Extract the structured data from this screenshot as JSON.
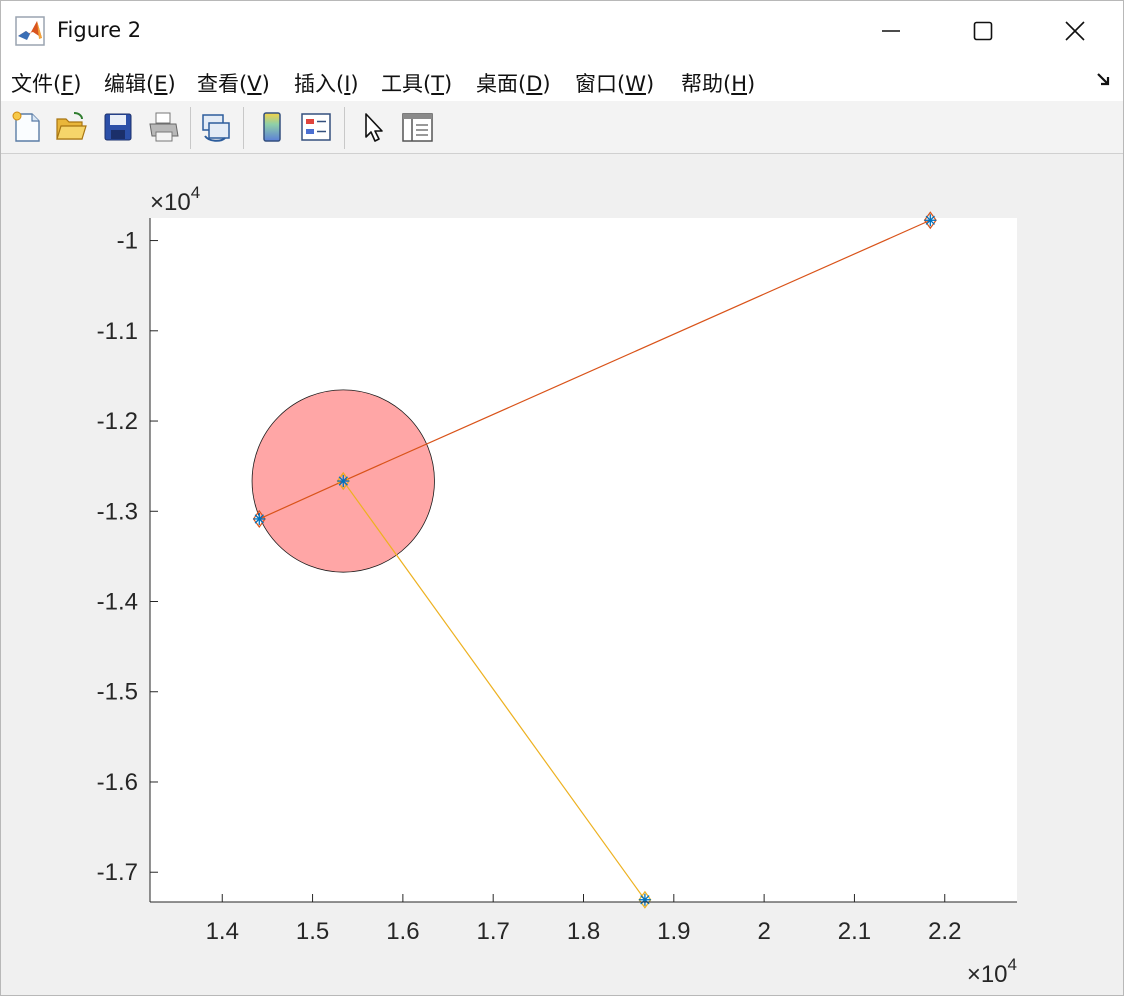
{
  "window": {
    "title": "Figure 2",
    "controls": [
      "minimize",
      "maximize",
      "close"
    ]
  },
  "menu": [
    {
      "label": "文件(",
      "key": "F",
      "end": ")"
    },
    {
      "label": "编辑(",
      "key": "E",
      "end": ")"
    },
    {
      "label": "查看(",
      "key": "V",
      "end": ")"
    },
    {
      "label": "插入(",
      "key": "I",
      "end": ")"
    },
    {
      "label": "工具(",
      "key": "T",
      "end": ")"
    },
    {
      "label": "桌面(",
      "key": "D",
      "end": ")"
    },
    {
      "label": "窗口(",
      "key": "W",
      "end": ")"
    },
    {
      "label": "帮助(",
      "key": "H",
      "end": ")"
    }
  ],
  "toolbar": {
    "icons": [
      "new-figure-icon",
      "open-file-icon",
      "save-icon",
      "print-icon",
      "link-plot-icon",
      "colorbar-icon",
      "legend-icon",
      "pointer-icon",
      "property-inspector-icon"
    ]
  },
  "colors": {
    "line1": "#d95319",
    "line2": "#edb120",
    "marker_star": "#0072bd",
    "circle_fill": "#ffa6a6",
    "axes_bg": "#ffffff"
  },
  "chart_data": {
    "type": "line",
    "x_exponent_label": "×10",
    "y_exponent_label": "×10",
    "exponent": "4",
    "xlim": [
      1.32,
      2.28
    ],
    "ylim": [
      -1.733,
      -0.975
    ],
    "x_ticks": [
      1.4,
      1.5,
      1.6,
      1.7,
      1.8,
      1.9,
      2,
      2.1,
      2.2
    ],
    "x_tick_labels": [
      "1.4",
      "1.5",
      "1.6",
      "1.7",
      "1.8",
      "1.9",
      "2",
      "2.1",
      "2.2"
    ],
    "y_ticks": [
      -1.0,
      -1.1,
      -1.2,
      -1.3,
      -1.4,
      -1.5,
      -1.6,
      -1.7
    ],
    "y_tick_labels": [
      "-1",
      "-1.1",
      "-1.2",
      "-1.3",
      "-1.4",
      "-1.5",
      "-1.6",
      "-1.7"
    ],
    "circle": {
      "center": [
        1.534,
        -1.2665
      ],
      "radius": 0.101
    },
    "series": [
      {
        "color": "#d95319",
        "marker": "diamond",
        "x": [
          1.441,
          1.534,
          2.184
        ],
        "y": [
          -1.3085,
          -1.2665,
          -0.9775
        ]
      },
      {
        "color": "#edb120",
        "marker": "diamond",
        "x": [
          1.534,
          1.868
        ],
        "y": [
          -1.2665,
          -1.7305
        ]
      }
    ],
    "star_points": {
      "x": [
        1.441,
        1.534,
        2.184,
        1.868
      ],
      "y": [
        -1.3085,
        -1.2665,
        -0.9775,
        -1.7305
      ]
    }
  }
}
